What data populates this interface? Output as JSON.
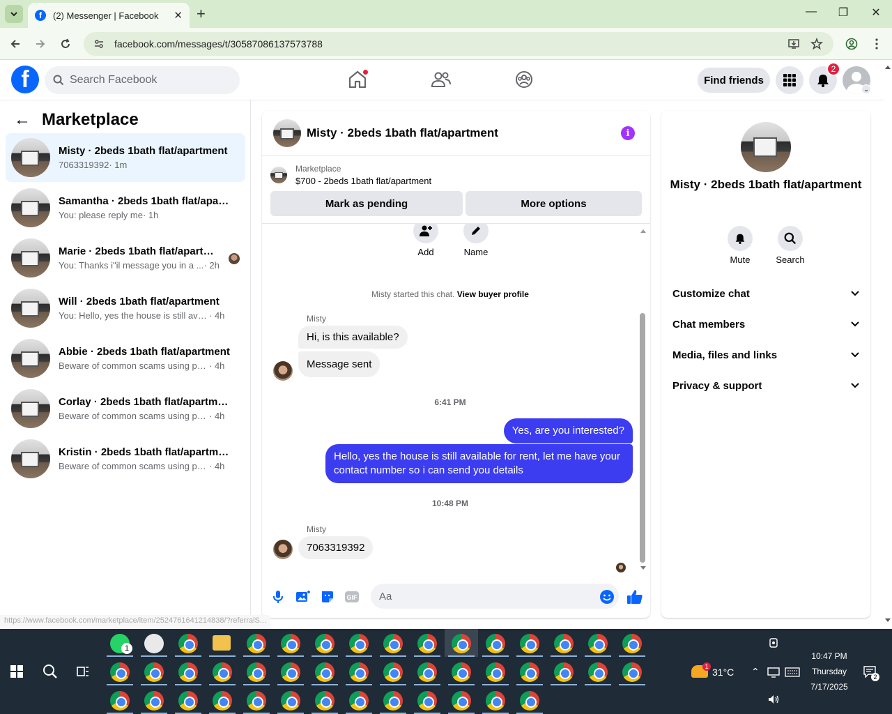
{
  "browser": {
    "tab_title": "(2) Messenger | Facebook",
    "url": "facebook.com/messages/t/30587086137573788",
    "status_url": "https://www.facebook.com/marketplace/item/2524761641214838/?referralS..."
  },
  "fb_header": {
    "search_placeholder": "Search Facebook",
    "find_friends": "Find friends",
    "notifications_count": "2"
  },
  "left": {
    "title": "Marketplace",
    "conversations": [
      {
        "name": "Misty · 2beds 1bath flat/apartment",
        "preview": "7063319392",
        "time": "· 1m"
      },
      {
        "name": "Samantha · 2beds 1bath flat/apartment",
        "preview": "You: please reply me",
        "time": "· 1h"
      },
      {
        "name": "Marie · 2beds 1bath flat/apartment",
        "preview": "You: Thanks i\"il message you in a ...",
        "time": "· 2h"
      },
      {
        "name": "Will · 2beds 1bath flat/apartment",
        "preview": "You: Hello, yes the house is still availa...",
        "time": "· 4h"
      },
      {
        "name": "Abbie · 2beds 1bath flat/apartment",
        "preview": "Beware of common scams using pay...",
        "time": "· 4h"
      },
      {
        "name": "Corlay · 2beds 1bath flat/apartment",
        "preview": "Beware of common scams using pay...",
        "time": "· 4h"
      },
      {
        "name": "Kristin · 2beds 1bath flat/apartment",
        "preview": "Beware of common scams using pay...",
        "time": "· 4h"
      }
    ]
  },
  "chat": {
    "title": "Misty · 2beds 1bath flat/apartment",
    "marketplace_label": "Marketplace",
    "listing": "$700 - 2beds 1bath flat/apartment",
    "mark_pending": "Mark as pending",
    "more_options": "More options",
    "add_label": "Add",
    "name_label": "Name",
    "started_text": "Misty started this chat.",
    "view_profile": "View buyer profile",
    "sender1": "Misty",
    "msg1": "Hi, is this available?",
    "msg2": "Message sent",
    "time1": "6:41 PM",
    "msg3": "Yes, are you interested?",
    "msg4": "Hello, yes the house is still available for rent, let me have your contact number so i can send you details",
    "time2": "10:48 PM",
    "sender2": "Misty",
    "msg5": "7063319392",
    "composer_placeholder": "Aa"
  },
  "right": {
    "name": "Misty · 2beds 1bath flat/apartment",
    "mute": "Mute",
    "search": "Search",
    "rows": [
      "Customize chat",
      "Chat members",
      "Media, files and links",
      "Privacy & support"
    ]
  },
  "taskbar": {
    "weather": "31°C",
    "time": "10:47 PM",
    "day": "Thursday",
    "date": "7/17/2025",
    "whatsapp_badge": "1",
    "notif_badge": "2"
  },
  "colors": {
    "fb_blue": "#0866ff",
    "outgoing_bubble": "#3c3cf0",
    "incoming_bubble": "#f0f0f0",
    "info_purple": "#a033ff"
  }
}
